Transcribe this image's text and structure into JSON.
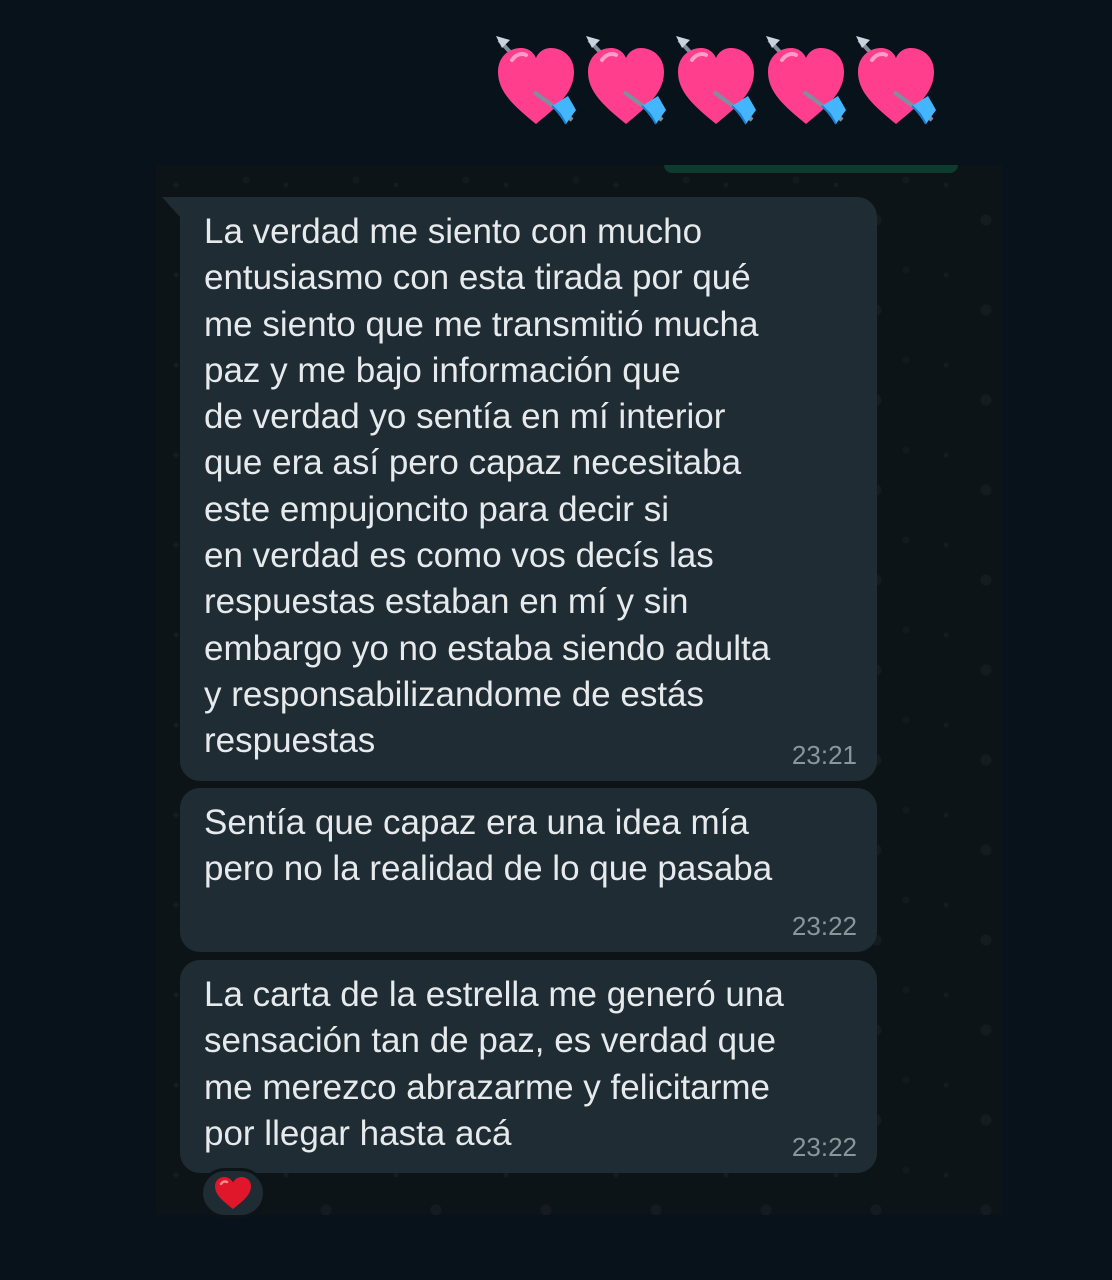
{
  "header": {
    "emoji_sequence": [
      "heart-with-arrow-icon",
      "heart-with-arrow-icon",
      "heart-with-arrow-icon",
      "heart-with-arrow-icon",
      "heart-with-arrow-icon"
    ]
  },
  "colors": {
    "background": "#08121a",
    "chat_wallpaper": "#0d1418",
    "bubble": "#202c33",
    "text": "#e6eaec",
    "timestamp": "#8b969c",
    "heart_pink": "#ff3f8e",
    "arrow_blue": "#43b6ff",
    "reaction_red": "#e0162b"
  },
  "messages": [
    {
      "text": "La verdad me siento con mucho\nentusiasmo con esta tirada por qué\nme siento que me transmitió mucha\npaz y me bajo información que\nde verdad yo sentía en mí interior\nque era así pero capaz necesitaba\neste empujoncito para decir si\nen verdad es como vos decís las\nrespuestas estaban en mí y sin\nembargo yo no estaba siendo adulta\ny responsabilizandome de estás\nrespuestas",
      "time": "23:21"
    },
    {
      "text": "Sentía que capaz era una idea mía\npero no la realidad de lo que pasaba",
      "time": "23:22"
    },
    {
      "text": "La carta de la estrella me generó una\nsensación tan de paz, es verdad que\nme merezco abrazarme y felicitarme\npor llegar hasta acá",
      "time": "23:22"
    }
  ],
  "reaction": {
    "icon": "red-heart-icon"
  }
}
